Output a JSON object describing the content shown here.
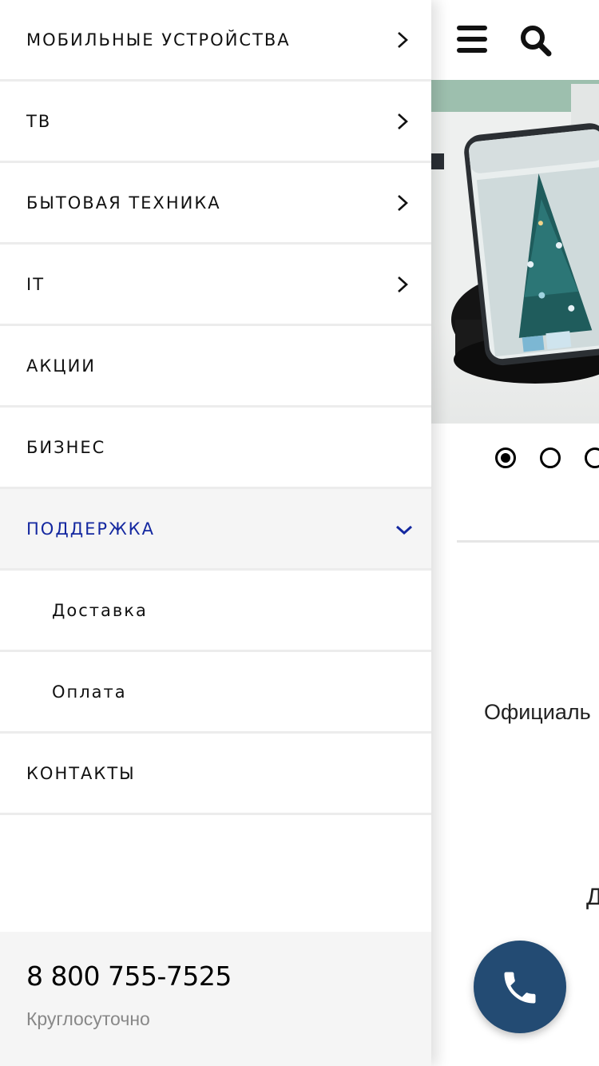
{
  "menu": {
    "items": [
      {
        "label": "МОБИЛЬНЫЕ УСТРОЙСТВА",
        "icon": "chevron-right-icon"
      },
      {
        "label": "ТВ",
        "icon": "chevron-right-icon"
      },
      {
        "label": "БЫТОВАЯ ТЕХНИКА",
        "icon": "chevron-right-icon"
      },
      {
        "label": "IT",
        "icon": "chevron-right-icon"
      },
      {
        "label": "АКЦИИ"
      },
      {
        "label": "БИЗНЕС"
      },
      {
        "label": "ПОДДЕРЖКА",
        "icon": "chevron-down-icon",
        "expanded": true
      },
      {
        "label": "Доставка",
        "submenu": true
      },
      {
        "label": "Оплата",
        "submenu": true
      },
      {
        "label": "КОНТАКТЫ"
      }
    ]
  },
  "footer": {
    "phone": "8 800 755-7525",
    "hours": "Круглосуточно"
  },
  "page": {
    "text_1": "Официаль",
    "text_2": "Д",
    "carousel": {
      "active_index": 0
    }
  },
  "colors": {
    "accent": "#1428a0",
    "call_button": "#234b73",
    "footer_bg": "#f5f5f5",
    "expanded_bg": "#f5f5f5",
    "divider": "#ececec"
  },
  "icons": [
    "hamburger-icon",
    "search-icon",
    "chevron-right-icon",
    "chevron-down-icon",
    "phone-icon"
  ]
}
